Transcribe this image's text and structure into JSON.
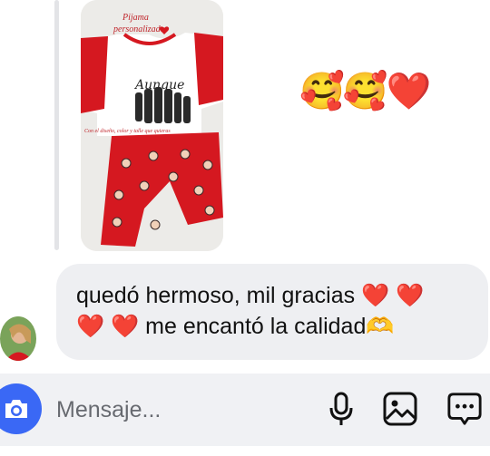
{
  "shared_photo": {
    "caption_title": "Pijama",
    "caption_subtitle": "personalizado",
    "shirt_print": "Aunque",
    "side_note": "Con el diseño, color y talle que quieras"
  },
  "reaction": {
    "emojis": "🥰🥰❤️"
  },
  "message": {
    "text_line1": "quedó hermoso, mil gracias",
    "hearts_line1": "❤️ ❤️",
    "hearts_line2": "❤️ ❤️",
    "text_line2": "me encantó la calidad",
    "hands_emoji": "🫶"
  },
  "composer": {
    "placeholder": "Mensaje..."
  },
  "colors": {
    "accent": "#3a68f5",
    "bubble": "#eeeff2",
    "composer": "#f0f1f4",
    "pajama_red": "#d51820"
  },
  "icons": {
    "camera": "camera-icon",
    "microphone": "microphone-icon",
    "gallery": "image-gallery-icon",
    "sticker": "sticker-icon"
  }
}
